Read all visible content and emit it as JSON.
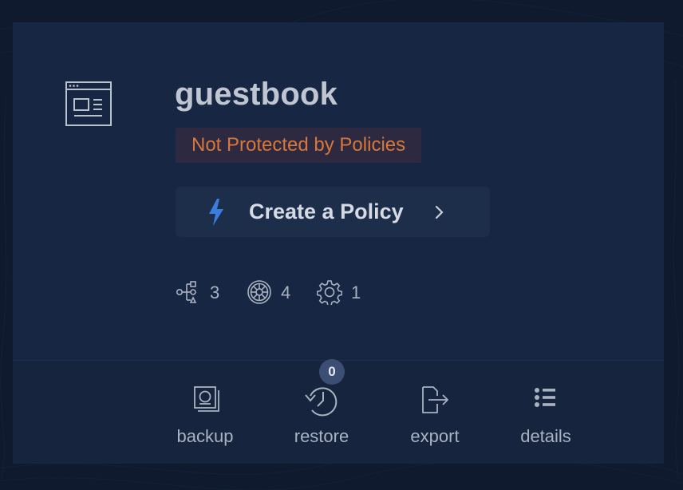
{
  "app": {
    "name": "guestbook",
    "icon": "application-window-icon"
  },
  "status": {
    "text": "Not Protected by Policies",
    "color": "#d9773a"
  },
  "create_policy": {
    "label": "Create a Policy",
    "icon": "lightning-bolt-icon",
    "accent": "#3b7ddd"
  },
  "stats": [
    {
      "name": "network-topology",
      "icon": "topology-icon",
      "count": "3"
    },
    {
      "name": "helm-charts",
      "icon": "helm-wheel-icon",
      "count": "4"
    },
    {
      "name": "configurations",
      "icon": "gear-icon",
      "count": "1"
    }
  ],
  "actions": {
    "backup": {
      "label": "backup",
      "icon": "backup-icon"
    },
    "restore": {
      "label": "restore",
      "icon": "restore-history-icon",
      "badge": "0"
    },
    "export": {
      "label": "export",
      "icon": "export-icon"
    },
    "details": {
      "label": "details",
      "icon": "list-icon"
    }
  }
}
